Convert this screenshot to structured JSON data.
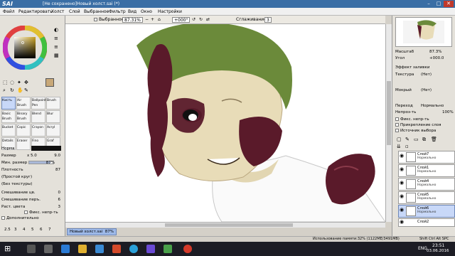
{
  "titlebar": {
    "logo": "SAI",
    "title": "[Не сохранено]Новый холст.sai (*)"
  },
  "menu": [
    "Файл",
    "Редактировать",
    "Холст",
    "Слой",
    "Выбранное",
    "Фильтр",
    "Вид",
    "Окно",
    "Настройки"
  ],
  "toolbar": {
    "selected_label": "Выбранное",
    "zoom": "87.31%",
    "rotation": "+000°",
    "smoothing_label": "Сглаживание",
    "smoothing_value": "3"
  },
  "tools": {
    "groups": [
      [
        "Кисть",
        "Air Brush",
        "Ballpoint Pen",
        "Brush"
      ],
      [
        "Basic Brush",
        "Binary Brush",
        "Blend",
        "Blur"
      ],
      [
        "Bucket",
        "Copic",
        "Crayon",
        "Acryl"
      ],
      [
        "Details",
        "Eraser",
        "Fino",
        "Graf"
      ]
    ],
    "mode": "Норма",
    "size_label": "Размер",
    "size_mult": "x 5.0",
    "size_value": "9.0",
    "min_size_label": "Мин. размер",
    "min_size_value": "87%",
    "density_label": "Плотность",
    "density_value": "87",
    "shape": "(Простой круг)",
    "texture": "(Без текстуры)",
    "blend_label": "Смешивание цв.",
    "blend_value": "0",
    "dilution_label": "Смешивание перъ.",
    "dilution_value": "6",
    "persistence_label": "Раст. цвета",
    "persistence_value": "3",
    "preserve_opacity": "Фикс. непр-ть",
    "advanced": "Дополнительно",
    "sizes": [
      "2.5",
      "3",
      "4",
      "5",
      "6",
      "7"
    ]
  },
  "navigator": {
    "zoom_label": "Масштаб",
    "zoom_value": "87.3%",
    "angle_label": "Угол",
    "angle_value": "+000.0"
  },
  "layer_effects": {
    "title": "Эффект заливки",
    "texture_label": "Текстура",
    "texture_value": "(Нет)",
    "effect_label": "Мокрый",
    "effect_value": "(Нет)",
    "blending_label": "Переход",
    "blending_value": "Нормально",
    "opacity_label": "Непроз-ть",
    "opacity_value": "100%",
    "checks": [
      "Фикс. непр-ть",
      "Прикрепление слоя",
      "Источник выбора"
    ]
  },
  "layers": [
    {
      "name": "Слой7",
      "mode": "Нормально",
      "opacity": "100%",
      "selected": false
    },
    {
      "name": "Слой1",
      "mode": "Нормально",
      "opacity": "100%",
      "selected": false
    },
    {
      "name": "Слой4",
      "mode": "Нормально",
      "opacity": "100%",
      "selected": false
    },
    {
      "name": "Слой5",
      "mode": "Нормально",
      "opacity": "100%",
      "selected": false
    },
    {
      "name": "Слой6",
      "mode": "Нормально",
      "opacity": "100%",
      "selected": true
    },
    {
      "name": "Слой2",
      "mode": "",
      "opacity": "",
      "selected": false
    }
  ],
  "document_tab": {
    "name": "Новый холст.sai",
    "zoom": "87%"
  },
  "status": {
    "memory": "Использование памяти:32% (1122ME/3491MB)",
    "keys": "Shift Ctrl Alt SPC"
  },
  "taskbar": {
    "lang": "ENG",
    "time": "23:51",
    "date": "03.06.2016"
  },
  "colors": {
    "accent": "#3a6ea5",
    "hair": "#6b8a3a",
    "skin": "#e8dcb8",
    "scar": "#5a1a2a"
  }
}
